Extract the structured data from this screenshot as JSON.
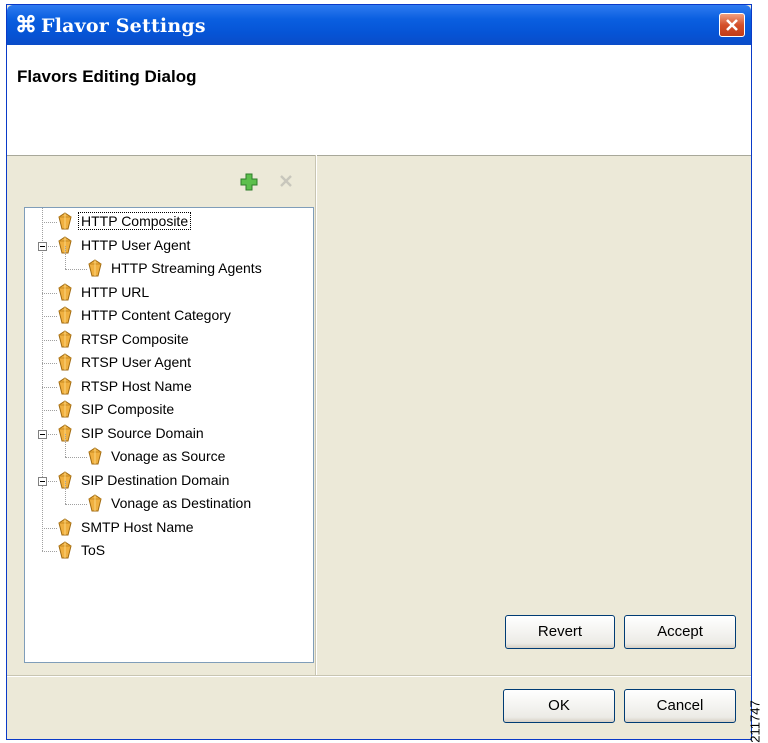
{
  "window": {
    "title": "Flavor Settings",
    "close_icon": "close-icon",
    "app_icon": "app-icon"
  },
  "header": {
    "title": "Flavors Editing Dialog"
  },
  "toolbar": {
    "add_icon": "add-icon",
    "delete_icon": "delete-icon"
  },
  "tree": {
    "items": [
      {
        "label": "HTTP Composite",
        "level": 0,
        "selected": true
      },
      {
        "label": "HTTP User Agent",
        "level": 0,
        "expanded": true
      },
      {
        "label": "HTTP Streaming Agents",
        "level": 1
      },
      {
        "label": "HTTP URL",
        "level": 0
      },
      {
        "label": "HTTP Content Category",
        "level": 0
      },
      {
        "label": "RTSP Composite",
        "level": 0
      },
      {
        "label": "RTSP User Agent",
        "level": 0
      },
      {
        "label": "RTSP Host Name",
        "level": 0
      },
      {
        "label": "SIP Composite",
        "level": 0
      },
      {
        "label": "SIP Source Domain",
        "level": 0,
        "expanded": true
      },
      {
        "label": "Vonage as Source",
        "level": 1
      },
      {
        "label": "SIP Destination Domain",
        "level": 0,
        "expanded": true
      },
      {
        "label": "Vonage as Destination",
        "level": 1
      },
      {
        "label": "SMTP Host Name",
        "level": 0
      },
      {
        "label": "ToS",
        "level": 0
      }
    ]
  },
  "buttons": {
    "revert": "Revert",
    "accept": "Accept",
    "ok": "OK",
    "cancel": "Cancel"
  },
  "figure_id": "211747",
  "colors": {
    "titlebar": "#0654d6",
    "dialog_bg": "#ece9d8",
    "add_green": "#3ea53a"
  }
}
